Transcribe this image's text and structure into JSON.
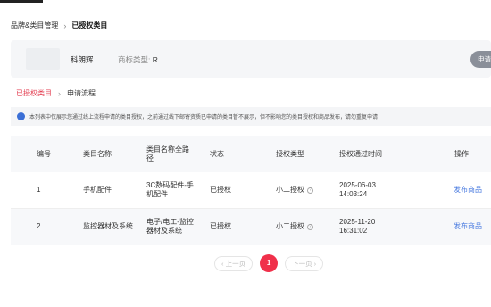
{
  "breadcrumb": {
    "parent": "品牌&类目管理",
    "separator": "›",
    "current": "已授权类目"
  },
  "brand": {
    "name": "科朗辉",
    "type_label": "商标类型:",
    "type_value": "R",
    "apply_button": "申请新"
  },
  "tabs": {
    "active": "已授权类目",
    "separator": "›",
    "second": "申请流程"
  },
  "notice": {
    "icon": "info-icon",
    "text": "本列表中仅展示您通过线上流程申请的类目授权，之前通过线下邮寄资质已申请的类目暂不展示，但不影响您的类目授权和商品发布，请勿重复申请"
  },
  "table": {
    "headers": [
      "编号",
      "类目名称",
      "类目名称全路径",
      "状态",
      "授权类型",
      "授权通过时间",
      "操作"
    ],
    "rows": [
      {
        "no": "1",
        "name": "手机配件",
        "path": "3C数码配件-手机配件",
        "status": "已授权",
        "auth_type": "小二授权",
        "time": "2025-06-03 14:03:24",
        "action": "发布商品"
      },
      {
        "no": "2",
        "name": "监控器材及系统",
        "path": "电子/电工-监控器材及系统",
        "status": "已授权",
        "auth_type": "小二授权",
        "time": "2025-11-20 16:31:02",
        "action": "发布商品"
      }
    ]
  },
  "pagination": {
    "prev": "‹ 上一页",
    "current": "1",
    "next": "下一页 ›"
  },
  "colors": {
    "accent": "#f0304a",
    "link": "#4a7be0",
    "info": "#3b6fd6"
  }
}
